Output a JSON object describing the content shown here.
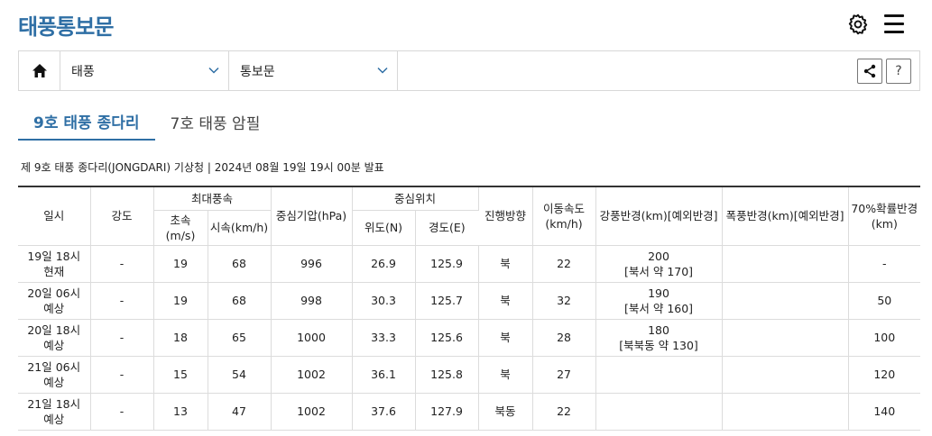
{
  "header": {
    "title": "태풍통보문",
    "settings_icon": "gear-icon",
    "menu_icon": "hamburger-icon"
  },
  "navbar": {
    "home_icon": "home-icon",
    "select1": "태풍",
    "select2": "통보문",
    "share_icon": "share-icon",
    "help_label": "?"
  },
  "tabs": [
    {
      "label": "9호 태풍 종다리",
      "active": true
    },
    {
      "label": "7호 태풍 암필",
      "active": false
    }
  ],
  "caption": "제 9호 태풍 종다리(JONGDARI) 기상청 | 2024년 08월 19일 19시 00분 발표",
  "table": {
    "headers": {
      "time": "일시",
      "intensity": "강도",
      "max_wind": "최대풍속",
      "wind_ms": "초속\n(m/s)",
      "wind_kmh": "시속\n(km/h)",
      "pressure": "중심기압(hPa)",
      "center": "중심위치",
      "lat": "위도(N)",
      "lon": "경도(E)",
      "direction": "진행\n방향",
      "speed": "이동\n속도\n(km/h)",
      "gale_radius": "강풍반경(km)\n[예외반경]",
      "storm_radius": "폭풍반경(km)\n[예외반경]",
      "prob_radius": "70%\n확률\n반경(km)"
    },
    "rows": [
      {
        "time": [
          "19일 18시",
          "현재"
        ],
        "intensity": "-",
        "ms": "19",
        "kmh": "68",
        "pressure": "996",
        "lat": "26.9",
        "lon": "125.9",
        "dir": "북",
        "speed": "22",
        "gale": [
          "200",
          "[북서 약 170]"
        ],
        "storm": "",
        "prob": "-"
      },
      {
        "time": [
          "20일 06시",
          "예상"
        ],
        "intensity": "-",
        "ms": "19",
        "kmh": "68",
        "pressure": "998",
        "lat": "30.3",
        "lon": "125.7",
        "dir": "북",
        "speed": "32",
        "gale": [
          "190",
          "[북서 약 160]"
        ],
        "storm": "",
        "prob": "50"
      },
      {
        "time": [
          "20일 18시",
          "예상"
        ],
        "intensity": "-",
        "ms": "18",
        "kmh": "65",
        "pressure": "1000",
        "lat": "33.3",
        "lon": "125.6",
        "dir": "북",
        "speed": "28",
        "gale": [
          "180",
          "[북북동 약 130]"
        ],
        "storm": "",
        "prob": "100"
      },
      {
        "time": [
          "21일 06시",
          "예상"
        ],
        "intensity": "-",
        "ms": "15",
        "kmh": "54",
        "pressure": "1002",
        "lat": "36.1",
        "lon": "125.8",
        "dir": "북",
        "speed": "27",
        "gale": [
          "",
          ""
        ],
        "storm": "",
        "prob": "120"
      },
      {
        "time": [
          "21일 18시",
          "예상"
        ],
        "intensity": "-",
        "ms": "13",
        "kmh": "47",
        "pressure": "1002",
        "lat": "37.6",
        "lon": "127.9",
        "dir": "북동",
        "speed": "22",
        "gale": [
          "",
          ""
        ],
        "storm": "",
        "prob": "140"
      }
    ]
  },
  "colors": {
    "brand": "#2f6fa5",
    "border": "#dcdcdc"
  }
}
